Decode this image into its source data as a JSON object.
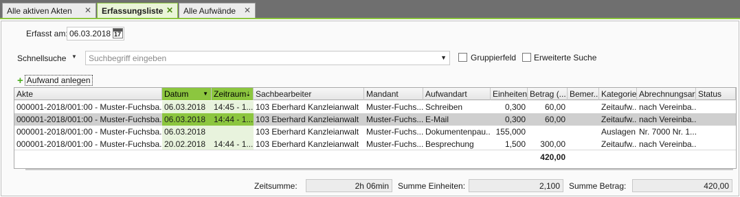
{
  "tabs": [
    {
      "label": "Alle aktiven Akten",
      "close": "✕"
    },
    {
      "label": "Erfassungsliste",
      "close": "✕"
    },
    {
      "label": "Alle Aufwände",
      "close": "✕"
    }
  ],
  "filter": {
    "date_label": "Erfasst am:",
    "date_value": "06.03.2018",
    "cal_day": "17",
    "quicksearch_label": "Schnellsuche",
    "search_placeholder": "Suchbegriff eingeben",
    "group_label": "Gruppierfeld",
    "extended_label": "Erweiterte Suche"
  },
  "toolbar": {
    "add_label": "Aufwand anlegen"
  },
  "table": {
    "columns": [
      "Akte",
      "Datum",
      "Zeitraum",
      "Sachbearbeiter",
      "Mandant",
      "Aufwandart",
      "Einheiten",
      "Betrag (...",
      "Bemer...",
      "Kategorie",
      "Abrechnungsart",
      "Status"
    ],
    "rows": [
      [
        "000001-2018/001:00  -  Muster-Fuchsba...",
        "06.03.2018",
        "14:45 - 1...",
        "103 Eberhard Kanzleianwalt",
        "Muster-Fuchs...",
        "Schreiben",
        "0,300",
        "60,00",
        "",
        "Zeitaufw...",
        "nach  Vereinba...",
        ""
      ],
      [
        "000001-2018/001:00  -  Muster-Fuchsba...",
        "06.03.2018",
        "14:44 - 1...",
        "103 Eberhard Kanzleianwalt",
        "Muster-Fuchs...",
        "E-Mail",
        "0,300",
        "60,00",
        "",
        "Zeitaufw...",
        "nach  Vereinba...",
        ""
      ],
      [
        "000001-2018/001:00  -  Muster-Fuchsba...",
        "06.03.2018",
        "",
        "103 Eberhard Kanzleianwalt",
        "Muster-Fuchs...",
        "Dokumentenpau...",
        "155,000",
        "",
        "",
        "Auslagen",
        "Nr. 7000 Nr. 1...",
        ""
      ],
      [
        "000001-2018/001:00  -  Muster-Fuchsba...",
        "20.02.2018",
        "14:44 - 1...",
        "103 Eberhard Kanzleianwalt",
        "Muster-Fuchs...",
        "Besprechung",
        "1,500",
        "300,00",
        "",
        "Zeitaufw...",
        "nach  Vereinba...",
        ""
      ]
    ],
    "total_betrag": "420,00"
  },
  "footer": {
    "zeitsumme_label": "Zeitsumme:",
    "zeitsumme_value": "2h 06min",
    "einheiten_label": "Summe Einheiten:",
    "einheiten_value": "2,100",
    "betrag_label": "Summe Betrag:",
    "betrag_value": "420,00"
  },
  "colors": {
    "accent": "#8cc63f",
    "tabbar": "#6f6f6f",
    "selected_row": "#cfcfcf"
  }
}
